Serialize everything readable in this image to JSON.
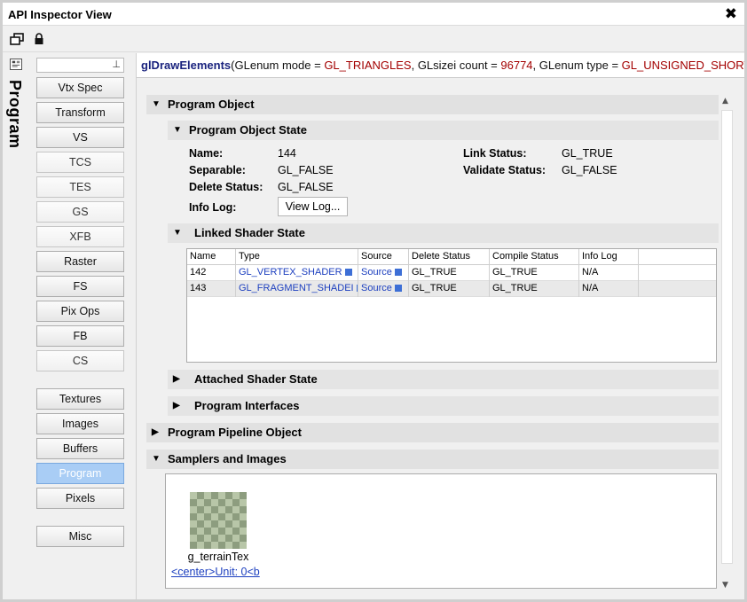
{
  "window": {
    "title": "API Inspector View",
    "close_icon": "close-icon"
  },
  "toolbar": {
    "icons": [
      "float-window-icon",
      "lock-icon"
    ]
  },
  "vertical_tab": {
    "label": "Program",
    "icon": "pipeline-icon"
  },
  "stage_filter": {
    "value": "",
    "pin_glyph": "⊥"
  },
  "stages": [
    {
      "label": "Vtx Spec",
      "state": "normal"
    },
    {
      "label": "Transform",
      "state": "normal"
    },
    {
      "label": "VS",
      "state": "normal"
    },
    {
      "label": "TCS",
      "state": "dim"
    },
    {
      "label": "TES",
      "state": "dim"
    },
    {
      "label": "GS",
      "state": "dim"
    },
    {
      "label": "XFB",
      "state": "dim"
    },
    {
      "label": "Raster",
      "state": "normal"
    },
    {
      "label": "FS",
      "state": "normal"
    },
    {
      "label": "Pix Ops",
      "state": "normal"
    },
    {
      "label": "FB",
      "state": "normal"
    },
    {
      "label": "CS",
      "state": "dim"
    }
  ],
  "resources": [
    {
      "label": "Textures",
      "state": "normal"
    },
    {
      "label": "Images",
      "state": "normal"
    },
    {
      "label": "Buffers",
      "state": "normal"
    },
    {
      "label": "Program",
      "state": "active"
    },
    {
      "label": "Pixels",
      "state": "normal"
    }
  ],
  "misc": {
    "label": "Misc"
  },
  "call": {
    "function": "glDrawElements",
    "open": "(",
    "p1": "GLenum mode = ",
    "v1": "GL_TRIANGLES",
    "sep1": ", ",
    "p2": "GLsizei count = ",
    "v2": "96774",
    "sep2": ", ",
    "p3": "GLenum type = ",
    "v3": "GL_UNSIGNED_SHORT..."
  },
  "sections": {
    "program_object": "Program Object",
    "program_object_state": "Program Object State",
    "linked_shader_state": "Linked Shader State",
    "attached_shader_state": "Attached Shader State",
    "program_interfaces": "Program Interfaces",
    "program_pipeline_object": "Program Pipeline Object",
    "samplers_and_images": "Samplers and Images"
  },
  "state": {
    "name_label": "Name:",
    "name": "144",
    "separable_label": "Separable:",
    "separable": "GL_FALSE",
    "delete_label": "Delete Status:",
    "delete": "GL_FALSE",
    "infolog_label": "Info Log:",
    "view_log": "View Log...",
    "link_label": "Link Status:",
    "link": "GL_TRUE",
    "validate_label": "Validate Status:",
    "validate": "GL_FALSE"
  },
  "shader_table": {
    "columns": [
      "Name",
      "Type",
      "Source",
      "Delete Status",
      "Compile Status",
      "Info Log"
    ],
    "rows": [
      [
        "142",
        "GL_VERTEX_SHADER",
        "Source",
        "GL_TRUE",
        "GL_TRUE",
        "N/A"
      ],
      [
        "143",
        "GL_FRAGMENT_SHADEI",
        "Source",
        "GL_TRUE",
        "GL_TRUE",
        "N/A"
      ]
    ]
  },
  "sampler": {
    "name": "g_terrainTex",
    "link": "<center>Unit: 0<b"
  }
}
